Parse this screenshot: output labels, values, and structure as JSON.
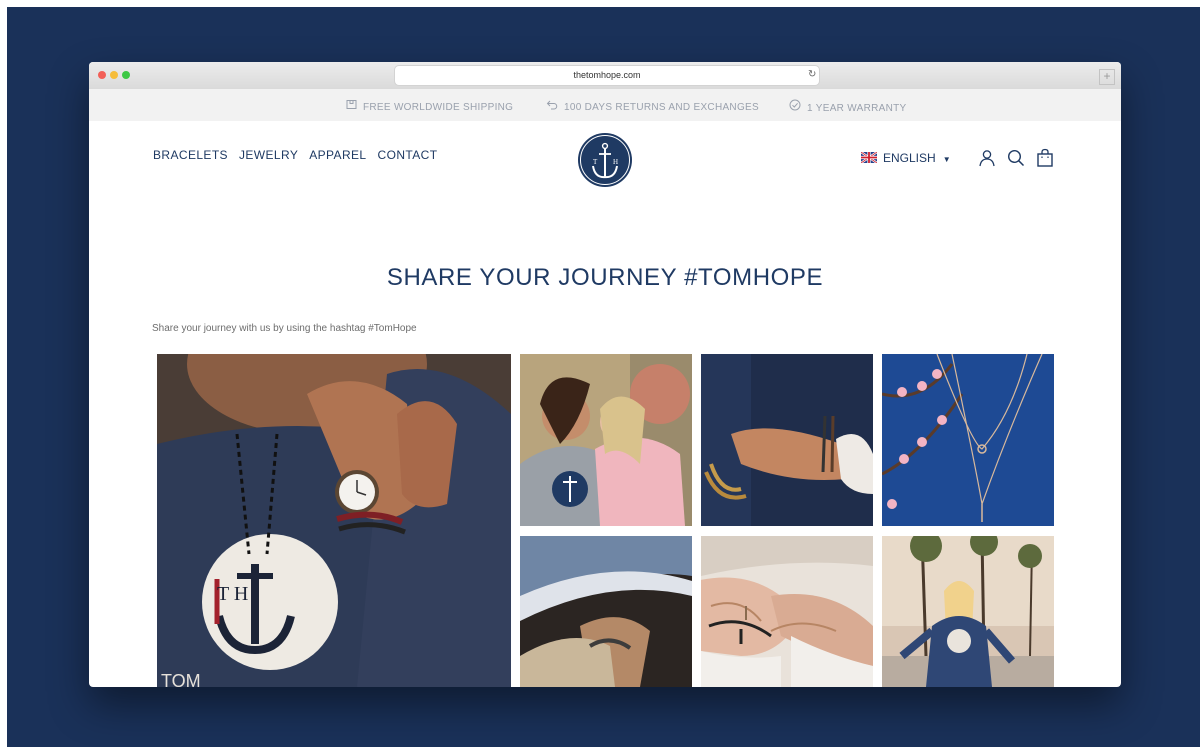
{
  "browser": {
    "url": "thetomhope.com"
  },
  "announcement": {
    "shipping": "FREE WORLDWIDE SHIPPING",
    "returns": "100 DAYS RETURNS AND EXCHANGES",
    "warranty": "1 YEAR WARRANTY"
  },
  "nav": {
    "items": [
      "BRACELETS",
      "JEWELRY",
      "APPAREL",
      "CONTACT"
    ]
  },
  "logo": {
    "letters": "T H"
  },
  "header": {
    "language": "ENGLISH"
  },
  "main": {
    "title": "SHARE YOUR JOURNEY #TOMHOPE",
    "subtitle": "Share your journey with us by using the hashtag #TomHope"
  },
  "gallery": {
    "hoodie_letters": "T H",
    "hoodie_text": "TOM"
  },
  "colors": {
    "brand_navy": "#1f3a63",
    "backdrop": "#1a3159",
    "announcement_bg": "#f2f2f2",
    "muted_text": "#9aa1ad"
  }
}
